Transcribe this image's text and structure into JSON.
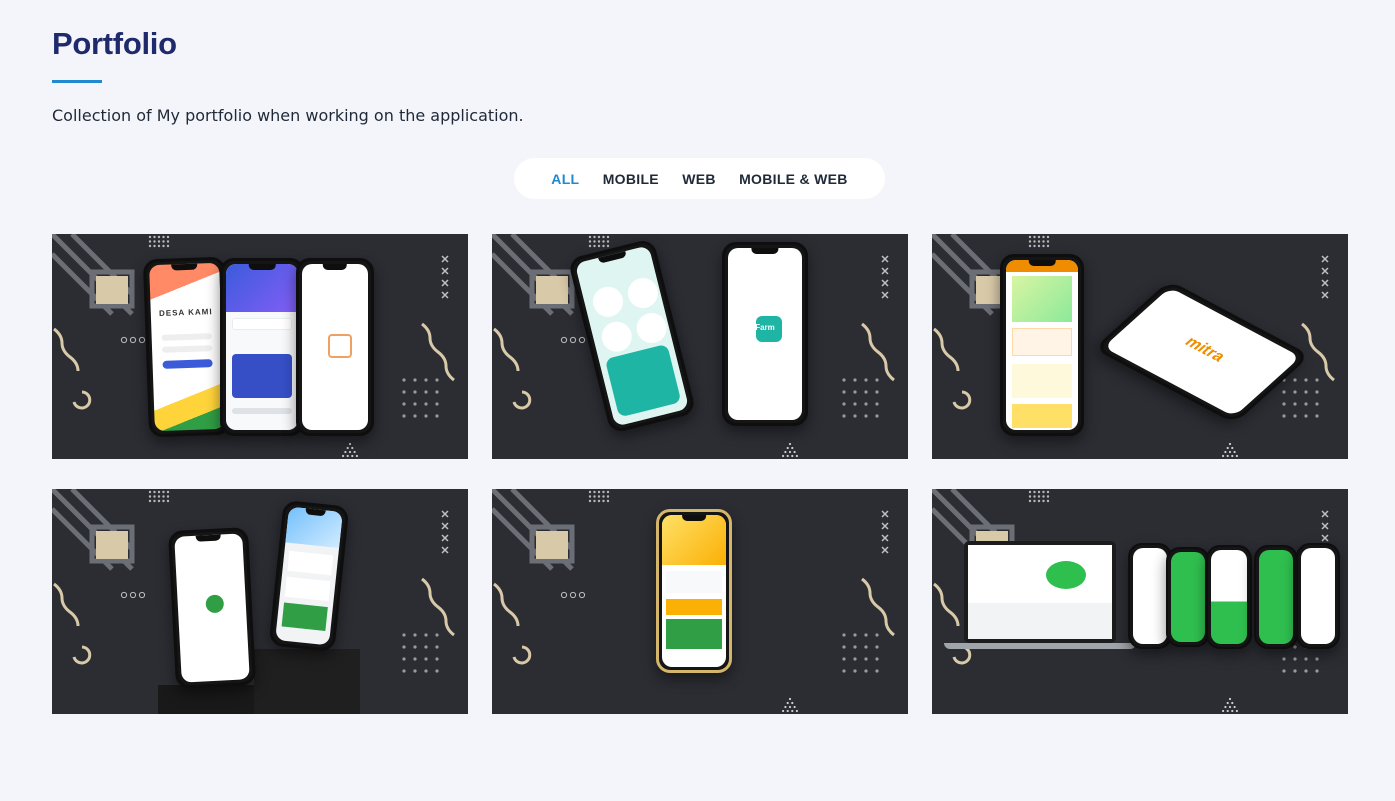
{
  "section": {
    "title": "Portfolio",
    "subtitle": "Collection of My portfolio when working on the application."
  },
  "filters": [
    {
      "label": "ALL",
      "active": true
    },
    {
      "label": "MOBILE",
      "active": false
    },
    {
      "label": "WEB",
      "active": false
    },
    {
      "label": "MOBILE & WEB",
      "active": false
    }
  ],
  "projects": [
    {
      "app_name": "DESA KAMI",
      "theme": "#3b5bdb"
    },
    {
      "app_name": "Farm",
      "theme": "#1fb5a5"
    },
    {
      "app_name": "mitra",
      "theme": "#f08c00"
    },
    {
      "app_name": "",
      "theme": "#2f9e44"
    },
    {
      "app_name": "",
      "theme": "#fcc419"
    },
    {
      "app_name": "",
      "theme": "#2fbf4f"
    }
  ],
  "colors": {
    "title": "#1e2a6b",
    "accent": "#1f8ad0",
    "background": "#f3f5fa",
    "card_background": "#2b2d33"
  }
}
